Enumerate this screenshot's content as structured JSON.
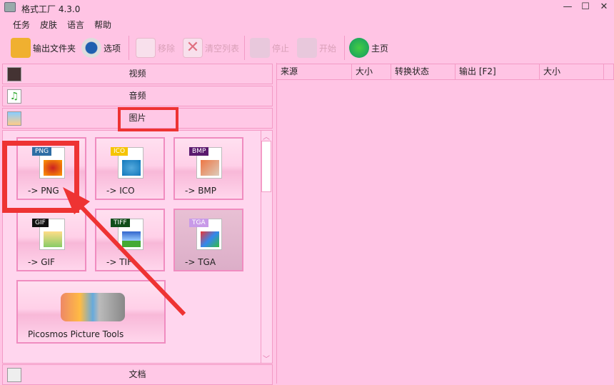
{
  "window": {
    "title": "格式工厂 4.3.0",
    "min": "—",
    "max": "☐",
    "close": "✕"
  },
  "menu": [
    "任务",
    "皮肤",
    "语言",
    "帮助"
  ],
  "toolbar": {
    "output_folder": "输出文件夹",
    "options": "选项",
    "remove": "移除",
    "clear": "清空列表",
    "stop": "停止",
    "start": "开始",
    "home": "主页"
  },
  "categories": {
    "video": "视频",
    "audio": "音频",
    "image": "图片",
    "document": "文档"
  },
  "tiles": [
    {
      "badge": "PNG",
      "label": "-> PNG",
      "color": "#2e6da4"
    },
    {
      "badge": "ICO",
      "label": "-> ICO",
      "color": "#f5c400"
    },
    {
      "badge": "BMP",
      "label": "-> BMP",
      "color": "#5a1a6e"
    },
    {
      "badge": "GIF",
      "label": "-> GIF",
      "color": "#111111"
    },
    {
      "badge": "TIFF",
      "label": "-> TIF",
      "color": "#114d1a"
    },
    {
      "badge": "TGA",
      "label": "-> TGA",
      "color": "#c89ae8"
    }
  ],
  "picosmos": "Picosmos Picture Tools",
  "columns": [
    "来源",
    "大小",
    "转换状态",
    "输出 [F2]",
    "大小"
  ],
  "scroll": {
    "up": "︿",
    "down": "﹀"
  }
}
